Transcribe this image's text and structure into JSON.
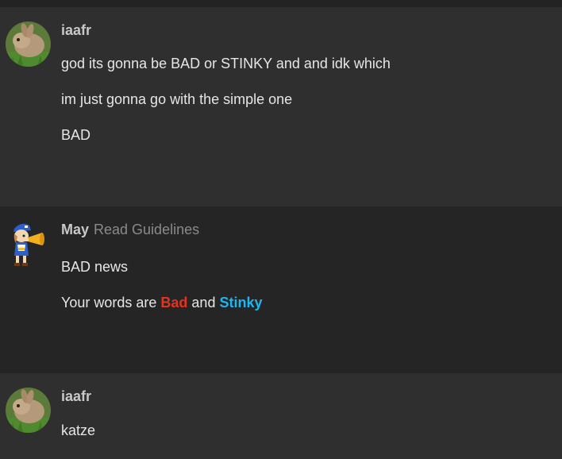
{
  "posts": [
    {
      "author": "iaafr",
      "role": "",
      "avatar": "bunny-avatar",
      "paragraphs": [
        "god its gonna be BAD or STINKY and and idk which",
        "im just gonna go with the simple one",
        "BAD"
      ]
    },
    {
      "author": "May",
      "role": "Read Guidelines",
      "avatar": "mascot-with-megaphone-avatar",
      "paragraphs": [
        "BAD news"
      ],
      "colored_line": {
        "prefix": "Your words are ",
        "word1": "Bad",
        "word1_color": "#e8321c",
        "middle": " and ",
        "word2": "Stinky",
        "word2_color": "#1fb5ee"
      }
    },
    {
      "author": "iaafr",
      "role": "",
      "avatar": "bunny-avatar",
      "paragraphs": [
        "katze"
      ]
    }
  ],
  "colors": {
    "background": "#2f2f2f",
    "alt_background": "#252525",
    "text": "#e6e6e6",
    "author": "#c8c8c8",
    "role": "#8a8a8a"
  }
}
